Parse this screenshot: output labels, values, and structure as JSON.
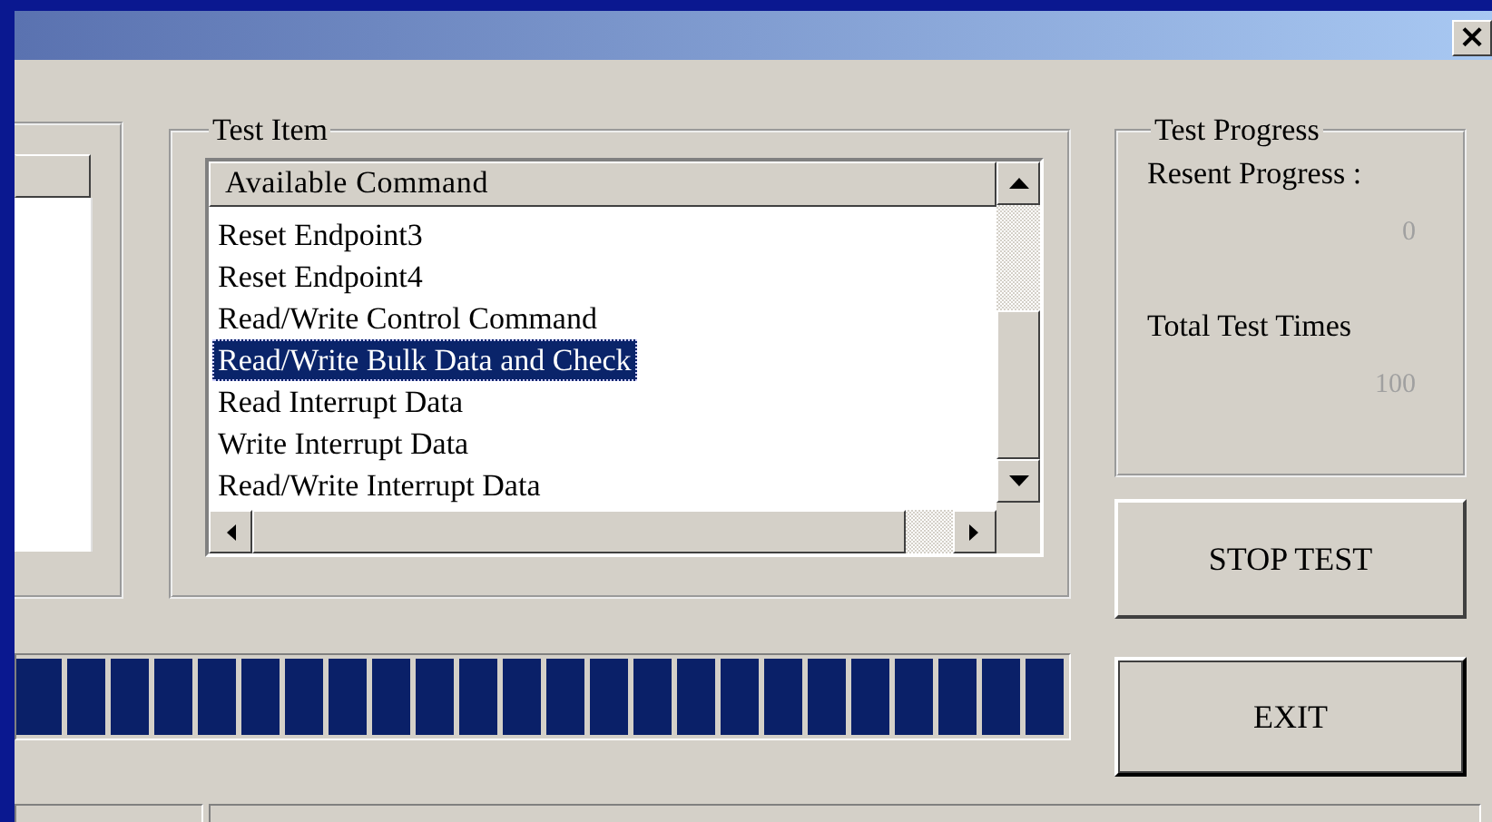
{
  "window": {
    "close": "×"
  },
  "test_item": {
    "title": "Test Item",
    "list_header": "Available Command",
    "items": [
      {
        "label": "Reset Endpoint3",
        "selected": false
      },
      {
        "label": "Reset Endpoint4",
        "selected": false
      },
      {
        "label": "Read/Write Control Command",
        "selected": false
      },
      {
        "label": "Read/Write Bulk Data and Check",
        "selected": true
      },
      {
        "label": "Read Interrupt Data",
        "selected": false
      },
      {
        "label": "Write Interrupt Data",
        "selected": false
      },
      {
        "label": "Read/Write Interrupt Data",
        "selected": false
      }
    ]
  },
  "test_progress": {
    "title": "Test Progress",
    "current_label": "Resent Progress :",
    "current_value": "0",
    "total_label": "Total Test Times",
    "total_value": "100"
  },
  "progress_bar": {
    "level": 1
  },
  "buttons": [
    {
      "label": "STOP TEST"
    },
    {
      "label": "EXIT"
    }
  ]
}
